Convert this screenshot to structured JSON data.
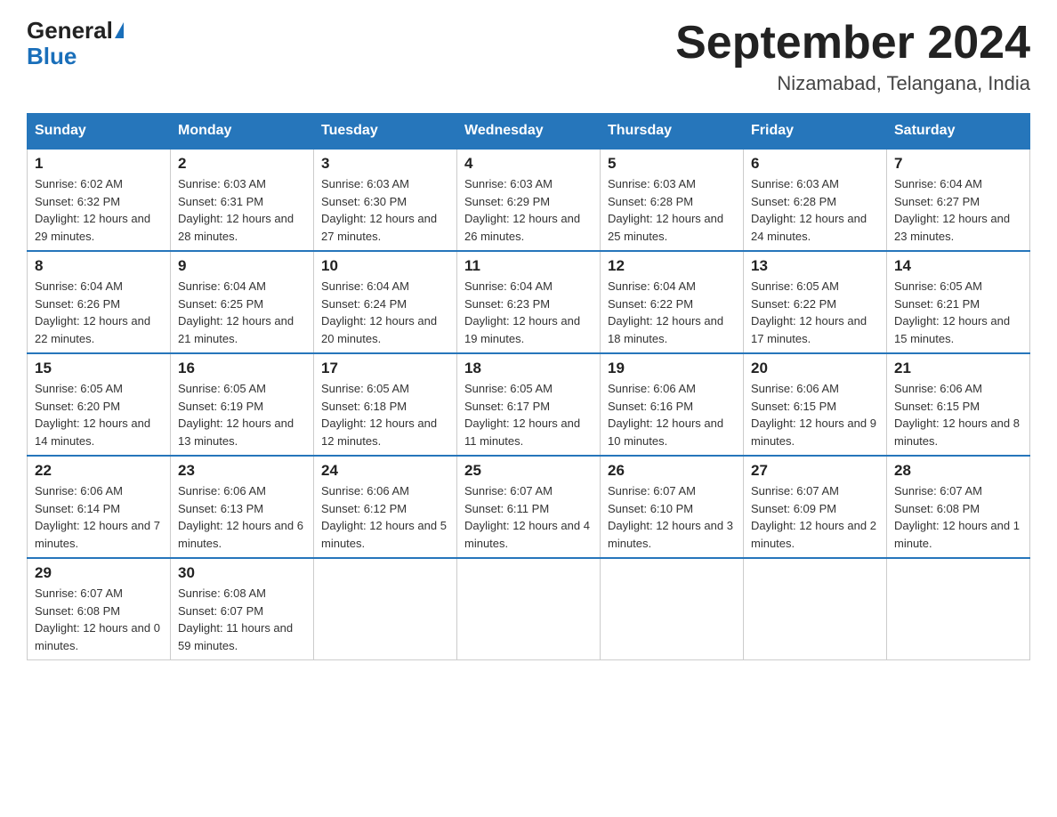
{
  "header": {
    "logo_general": "General",
    "logo_blue": "Blue",
    "month_title": "September 2024",
    "location": "Nizamabad, Telangana, India"
  },
  "columns": [
    "Sunday",
    "Monday",
    "Tuesday",
    "Wednesday",
    "Thursday",
    "Friday",
    "Saturday"
  ],
  "weeks": [
    [
      {
        "day": "1",
        "sunrise": "Sunrise: 6:02 AM",
        "sunset": "Sunset: 6:32 PM",
        "daylight": "Daylight: 12 hours and 29 minutes."
      },
      {
        "day": "2",
        "sunrise": "Sunrise: 6:03 AM",
        "sunset": "Sunset: 6:31 PM",
        "daylight": "Daylight: 12 hours and 28 minutes."
      },
      {
        "day": "3",
        "sunrise": "Sunrise: 6:03 AM",
        "sunset": "Sunset: 6:30 PM",
        "daylight": "Daylight: 12 hours and 27 minutes."
      },
      {
        "day": "4",
        "sunrise": "Sunrise: 6:03 AM",
        "sunset": "Sunset: 6:29 PM",
        "daylight": "Daylight: 12 hours and 26 minutes."
      },
      {
        "day": "5",
        "sunrise": "Sunrise: 6:03 AM",
        "sunset": "Sunset: 6:28 PM",
        "daylight": "Daylight: 12 hours and 25 minutes."
      },
      {
        "day": "6",
        "sunrise": "Sunrise: 6:03 AM",
        "sunset": "Sunset: 6:28 PM",
        "daylight": "Daylight: 12 hours and 24 minutes."
      },
      {
        "day": "7",
        "sunrise": "Sunrise: 6:04 AM",
        "sunset": "Sunset: 6:27 PM",
        "daylight": "Daylight: 12 hours and 23 minutes."
      }
    ],
    [
      {
        "day": "8",
        "sunrise": "Sunrise: 6:04 AM",
        "sunset": "Sunset: 6:26 PM",
        "daylight": "Daylight: 12 hours and 22 minutes."
      },
      {
        "day": "9",
        "sunrise": "Sunrise: 6:04 AM",
        "sunset": "Sunset: 6:25 PM",
        "daylight": "Daylight: 12 hours and 21 minutes."
      },
      {
        "day": "10",
        "sunrise": "Sunrise: 6:04 AM",
        "sunset": "Sunset: 6:24 PM",
        "daylight": "Daylight: 12 hours and 20 minutes."
      },
      {
        "day": "11",
        "sunrise": "Sunrise: 6:04 AM",
        "sunset": "Sunset: 6:23 PM",
        "daylight": "Daylight: 12 hours and 19 minutes."
      },
      {
        "day": "12",
        "sunrise": "Sunrise: 6:04 AM",
        "sunset": "Sunset: 6:22 PM",
        "daylight": "Daylight: 12 hours and 18 minutes."
      },
      {
        "day": "13",
        "sunrise": "Sunrise: 6:05 AM",
        "sunset": "Sunset: 6:22 PM",
        "daylight": "Daylight: 12 hours and 17 minutes."
      },
      {
        "day": "14",
        "sunrise": "Sunrise: 6:05 AM",
        "sunset": "Sunset: 6:21 PM",
        "daylight": "Daylight: 12 hours and 15 minutes."
      }
    ],
    [
      {
        "day": "15",
        "sunrise": "Sunrise: 6:05 AM",
        "sunset": "Sunset: 6:20 PM",
        "daylight": "Daylight: 12 hours and 14 minutes."
      },
      {
        "day": "16",
        "sunrise": "Sunrise: 6:05 AM",
        "sunset": "Sunset: 6:19 PM",
        "daylight": "Daylight: 12 hours and 13 minutes."
      },
      {
        "day": "17",
        "sunrise": "Sunrise: 6:05 AM",
        "sunset": "Sunset: 6:18 PM",
        "daylight": "Daylight: 12 hours and 12 minutes."
      },
      {
        "day": "18",
        "sunrise": "Sunrise: 6:05 AM",
        "sunset": "Sunset: 6:17 PM",
        "daylight": "Daylight: 12 hours and 11 minutes."
      },
      {
        "day": "19",
        "sunrise": "Sunrise: 6:06 AM",
        "sunset": "Sunset: 6:16 PM",
        "daylight": "Daylight: 12 hours and 10 minutes."
      },
      {
        "day": "20",
        "sunrise": "Sunrise: 6:06 AM",
        "sunset": "Sunset: 6:15 PM",
        "daylight": "Daylight: 12 hours and 9 minutes."
      },
      {
        "day": "21",
        "sunrise": "Sunrise: 6:06 AM",
        "sunset": "Sunset: 6:15 PM",
        "daylight": "Daylight: 12 hours and 8 minutes."
      }
    ],
    [
      {
        "day": "22",
        "sunrise": "Sunrise: 6:06 AM",
        "sunset": "Sunset: 6:14 PM",
        "daylight": "Daylight: 12 hours and 7 minutes."
      },
      {
        "day": "23",
        "sunrise": "Sunrise: 6:06 AM",
        "sunset": "Sunset: 6:13 PM",
        "daylight": "Daylight: 12 hours and 6 minutes."
      },
      {
        "day": "24",
        "sunrise": "Sunrise: 6:06 AM",
        "sunset": "Sunset: 6:12 PM",
        "daylight": "Daylight: 12 hours and 5 minutes."
      },
      {
        "day": "25",
        "sunrise": "Sunrise: 6:07 AM",
        "sunset": "Sunset: 6:11 PM",
        "daylight": "Daylight: 12 hours and 4 minutes."
      },
      {
        "day": "26",
        "sunrise": "Sunrise: 6:07 AM",
        "sunset": "Sunset: 6:10 PM",
        "daylight": "Daylight: 12 hours and 3 minutes."
      },
      {
        "day": "27",
        "sunrise": "Sunrise: 6:07 AM",
        "sunset": "Sunset: 6:09 PM",
        "daylight": "Daylight: 12 hours and 2 minutes."
      },
      {
        "day": "28",
        "sunrise": "Sunrise: 6:07 AM",
        "sunset": "Sunset: 6:08 PM",
        "daylight": "Daylight: 12 hours and 1 minute."
      }
    ],
    [
      {
        "day": "29",
        "sunrise": "Sunrise: 6:07 AM",
        "sunset": "Sunset: 6:08 PM",
        "daylight": "Daylight: 12 hours and 0 minutes."
      },
      {
        "day": "30",
        "sunrise": "Sunrise: 6:08 AM",
        "sunset": "Sunset: 6:07 PM",
        "daylight": "Daylight: 11 hours and 59 minutes."
      },
      null,
      null,
      null,
      null,
      null
    ]
  ]
}
